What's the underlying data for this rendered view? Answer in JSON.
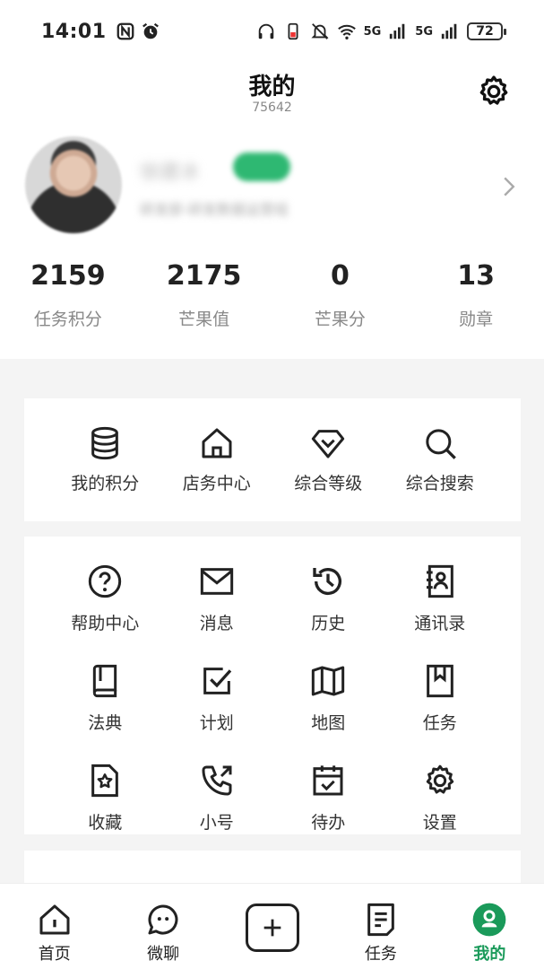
{
  "status_bar": {
    "time": "14:01",
    "battery": "72",
    "network_1": "5G",
    "network_2": "5G"
  },
  "header": {
    "title": "我的",
    "subtitle": "75642"
  },
  "profile": {
    "name": "徐建冰",
    "tag": "在岗",
    "department": "研发部-研发数据运营组"
  },
  "stats": [
    {
      "value": "2159",
      "label": "任务积分"
    },
    {
      "value": "2175",
      "label": "芒果值"
    },
    {
      "value": "0",
      "label": "芒果分"
    },
    {
      "value": "13",
      "label": "勋章"
    }
  ],
  "quick_actions": [
    {
      "label": "我的积分",
      "icon": "database-icon"
    },
    {
      "label": "店务中心",
      "icon": "home-icon"
    },
    {
      "label": "综合等级",
      "icon": "diamond-icon"
    },
    {
      "label": "综合搜索",
      "icon": "search-icon"
    }
  ],
  "tools": [
    {
      "label": "帮助中心",
      "icon": "help-icon"
    },
    {
      "label": "消息",
      "icon": "mail-icon"
    },
    {
      "label": "历史",
      "icon": "history-icon"
    },
    {
      "label": "通讯录",
      "icon": "contacts-icon"
    },
    {
      "label": "法典",
      "icon": "book-icon"
    },
    {
      "label": "计划",
      "icon": "checkbox-icon"
    },
    {
      "label": "地图",
      "icon": "map-icon"
    },
    {
      "label": "任务",
      "icon": "bookmark-icon"
    },
    {
      "label": "收藏",
      "icon": "favorite-icon"
    },
    {
      "label": "小号",
      "icon": "phone-icon"
    },
    {
      "label": "待办",
      "icon": "calendar-check-icon"
    },
    {
      "label": "设置",
      "icon": "gear-icon"
    }
  ],
  "bottom_nav": [
    {
      "label": "首页",
      "icon": "home-icon"
    },
    {
      "label": "微聊",
      "icon": "chat-icon"
    },
    {
      "label": "",
      "icon": "plus-icon"
    },
    {
      "label": "任务",
      "icon": "task-icon"
    },
    {
      "label": "我的",
      "icon": "user-icon",
      "active": true
    }
  ],
  "colors": {
    "accent": "#1a9a5a",
    "tag": "#2eb872",
    "background": "#f4f4f4"
  }
}
